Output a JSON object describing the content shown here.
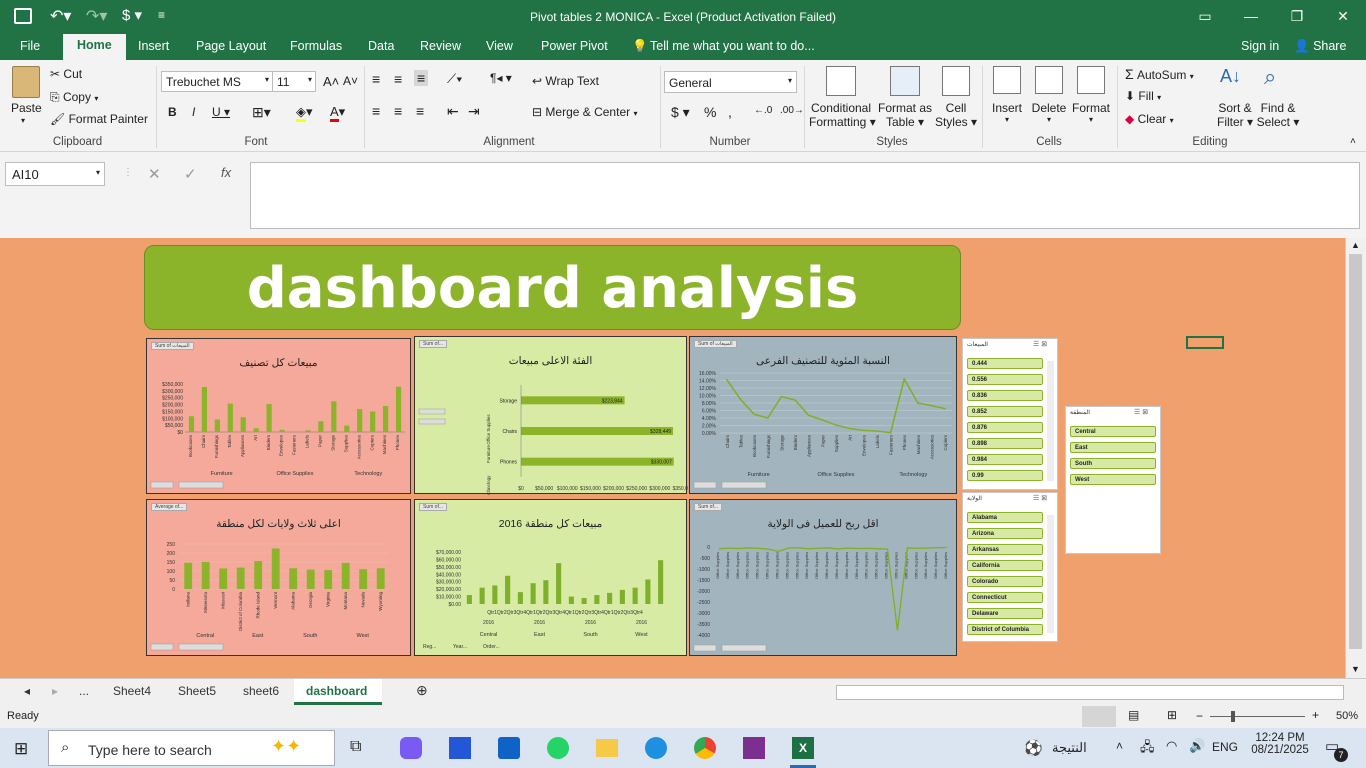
{
  "titlebar": {
    "title": "Pivot tables 2 MONICA - Excel (Product Activation Failed)"
  },
  "ribbon_tabs": [
    "File",
    "Home",
    "Insert",
    "Page Layout",
    "Formulas",
    "Data",
    "Review",
    "View",
    "Power Pivot"
  ],
  "tell_me": "Tell me what you want to do...",
  "sign_in": "Sign in",
  "share": "Share",
  "clipboard": {
    "paste": "Paste",
    "cut": "Cut",
    "copy": "Copy",
    "format_painter": "Format Painter",
    "group": "Clipboard"
  },
  "font": {
    "name": "Trebuchet MS",
    "size": "11",
    "group": "Font"
  },
  "alignment": {
    "wrap": "Wrap Text",
    "merge": "Merge & Center",
    "group": "Alignment"
  },
  "number": {
    "format": "General",
    "group": "Number"
  },
  "styles": {
    "cond1": "Conditional",
    "cond2": "Formatting",
    "fmt1": "Format as",
    "fmt2": "Table",
    "cell1": "Cell",
    "cell2": "Styles",
    "group": "Styles"
  },
  "cells": {
    "insert": "Insert",
    "delete": "Delete",
    "format": "Format",
    "group": "Cells"
  },
  "editing": {
    "autosum": "AutoSum",
    "fill": "Fill",
    "clear": "Clear",
    "sort1": "Sort &",
    "sort2": "Filter",
    "find1": "Find &",
    "find2": "Select",
    "group": "Editing"
  },
  "namebox": "AI10",
  "fx": "fx",
  "dashboard_title": "dashboard analysis",
  "charts": {
    "c1": {
      "title": "مبيعات كل تصنيف",
      "pill": "Sum of المبيعات",
      "ticks": [
        "$350,000",
        "$300,000",
        "$250,000",
        "$200,000",
        "$150,000",
        "$100,000",
        "$50,000",
        "$0"
      ],
      "cats": [
        "Bookcases",
        "Chairs",
        "Furnishings",
        "Tables",
        "Appliances",
        "Art",
        "Binders",
        "Envelopes",
        "Fasteners",
        "Labels",
        "Paper",
        "Storage",
        "Supplies",
        "Accessories",
        "Copiers",
        "Machines",
        "Phones"
      ],
      "groups": [
        "Furniture",
        "Office Supplies",
        "Technology"
      ]
    },
    "c2": {
      "title": "الفئة الاعلى مبيعات",
      "pill": "Sum of...",
      "xticks": [
        "$0",
        "$50,000",
        "$100,000",
        "$150,000",
        "$200,000",
        "$250,000",
        "$300,000",
        "$350,000"
      ]
    },
    "c3": {
      "title": "النسبة المئوية للتصنيف الفرعى",
      "pill": "Sum of المبيعات",
      "ticks": [
        "16.00%",
        "14.00%",
        "12.00%",
        "10.00%",
        "8.00%",
        "6.00%",
        "4.00%",
        "2.00%",
        "0.00%"
      ],
      "cats": [
        "Chairs",
        "Tables",
        "Bookcases",
        "Furnishings",
        "Storage",
        "Binders",
        "Appliances",
        "Paper",
        "Supplies",
        "Art",
        "Envelopes",
        "Labels",
        "Fasteners",
        "Phones",
        "Machines",
        "Accessories",
        "Copiers"
      ],
      "groups": [
        "Furniture",
        "Office Supplies",
        "Technology"
      ]
    },
    "c4": {
      "title": "اعلى ثلاث ولايات لكل منطقة",
      "pill": "Average of...",
      "ticks": [
        "250",
        "200",
        "150",
        "100",
        "50",
        "0"
      ],
      "cats": [
        "Indiana",
        "Minnesota",
        "Missouri",
        "District of Columbia",
        "Rhode Island",
        "Vermont",
        "Alabama",
        "Georgia",
        "Virginia",
        "Montana",
        "Nevada",
        "Wyoming"
      ],
      "groups": [
        "Central",
        "East",
        "South",
        "West"
      ]
    },
    "c5": {
      "title": "مبيعات كل منطقة 2016",
      "pill": "Sum of...",
      "ticks": [
        "$70,000.00",
        "$60,000.00",
        "$50,000.00",
        "$40,000.00",
        "$30,000.00",
        "$20,000.00",
        "$10,000.00",
        "$0.00"
      ],
      "xcats": "Qtr1Qtr2Qtr3Qtr4Qtr1Qtr2Qtr3Qtr4Qtr1Qtr2Qtr3Qtr4Qtr1Qtr2Qtr3Qtr4",
      "year": "2016",
      "groups": [
        "Central",
        "East",
        "South",
        "West"
      ],
      "filters": [
        "Reg...",
        "Year...",
        "Order..."
      ]
    },
    "c6": {
      "title": "اقل ربح للعميل فى الولاية",
      "pill": "Sum of...",
      "ticks": [
        "0",
        "-500",
        "-1000",
        "-1500",
        "-2000",
        "-2500",
        "-3000",
        "-3500",
        "-4000"
      ]
    }
  },
  "chart_data": [
    {
      "type": "bar",
      "title": "مبيعات كل تصنيف",
      "categories": [
        "Bookcases",
        "Chairs",
        "Furnishings",
        "Tables",
        "Appliances",
        "Art",
        "Binders",
        "Envelopes",
        "Fasteners",
        "Labels",
        "Paper",
        "Storage",
        "Supplies",
        "Accessories",
        "Copiers",
        "Machines",
        "Phones"
      ],
      "values": [
        114880,
        328449,
        91705,
        206966,
        107532,
        27119,
        203413,
        16476,
        3024,
        12486,
        78479,
        223844,
        46674,
        167380,
        149528,
        189239,
        330007
      ],
      "ylim": [
        0,
        350000
      ],
      "color": "#8cb42b"
    },
    {
      "type": "bar",
      "orientation": "horizontal",
      "title": "الفئة الاعلى مبيعات",
      "categories": [
        "Storage",
        "Chairs",
        "Phones"
      ],
      "groups": [
        "Office Supplies",
        "Furniture",
        "Technology"
      ],
      "values": [
        223844,
        328449,
        330007
      ],
      "xlim": [
        0,
        350000
      ]
    },
    {
      "type": "line",
      "title": "النسبة المئوية للتصنيف الفرعى",
      "categories": [
        "Chairs",
        "Tables",
        "Bookcases",
        "Furnishings",
        "Storage",
        "Binders",
        "Appliances",
        "Paper",
        "Supplies",
        "Art",
        "Envelopes",
        "Labels",
        "Fasteners",
        "Phones",
        "Machines",
        "Accessories",
        "Copiers"
      ],
      "values": [
        14.2,
        9.0,
        5.0,
        4.0,
        9.7,
        8.8,
        4.7,
        3.5,
        2.1,
        1.2,
        0.7,
        0.5,
        0.1,
        14.4,
        8.0,
        7.3,
        6.5
      ],
      "ylim": [
        0,
        16
      ]
    },
    {
      "type": "bar",
      "title": "اعلى ثلاث ولايات لكل منطقة",
      "categories": [
        "Indiana",
        "Minnesota",
        "Missouri",
        "District of Columbia",
        "Rhode Island",
        "Vermont",
        "Alabama",
        "Georgia",
        "Virginia",
        "Montana",
        "Nevada",
        "Wyoming"
      ],
      "values": [
        146,
        150,
        114,
        119,
        155,
        225,
        115,
        108,
        105,
        145,
        110,
        115
      ],
      "ylim": [
        0,
        250
      ]
    },
    {
      "type": "bar",
      "title": "مبيعات كل منطقة 2016",
      "categories": [
        "Central Qtr1",
        "Central Qtr2",
        "Central Qtr3",
        "Central Qtr4",
        "East Qtr1",
        "East Qtr2",
        "East Qtr3",
        "East Qtr4",
        "South Qtr1",
        "South Qtr2",
        "South Qtr3",
        "South Qtr4",
        "West Qtr1",
        "West Qtr2",
        "West Qtr3",
        "West Qtr4"
      ],
      "values": [
        12000,
        22000,
        25000,
        38000,
        16000,
        28000,
        32000,
        55000,
        10000,
        8000,
        12000,
        15000,
        19000,
        22000,
        33000,
        59000
      ],
      "ylim": [
        0,
        70000
      ]
    },
    {
      "type": "line",
      "title": "اقل ربح للعميل فى الولاية",
      "values": [
        -80,
        -50,
        -70,
        -40,
        -60,
        -100,
        -200,
        -50,
        -30,
        -80,
        -60,
        -40,
        -90,
        -50,
        -70,
        -60,
        -80,
        -100,
        -3800,
        -40,
        -60,
        -50,
        -30,
        -20
      ],
      "ylim": [
        -4000,
        0
      ]
    }
  ],
  "slicers": {
    "sales": {
      "header": "المبيعات",
      "items": [
        "0.444",
        "0.556",
        "0.836",
        "0.852",
        "0.876",
        "0.898",
        "0.984",
        "0.99"
      ]
    },
    "region": {
      "header": "المنطقة",
      "items": [
        "Central",
        "East",
        "South",
        "West"
      ]
    },
    "state": {
      "header": "الولاية",
      "items": [
        "Alabama",
        "Arizona",
        "Arkansas",
        "California",
        "Colorado",
        "Connecticut",
        "Delaware",
        "District of Columbia"
      ]
    }
  },
  "sheets": [
    "...",
    "Sheet4",
    "Sheet5",
    "sheet6",
    "dashboard"
  ],
  "status": {
    "ready": "Ready",
    "zoom": "50%"
  },
  "taskbar": {
    "search": "Type here to search",
    "weather": "النتيجة",
    "lang": "ENG",
    "time": "12:24 PM",
    "date": "08/21/2025",
    "notif": "7"
  }
}
